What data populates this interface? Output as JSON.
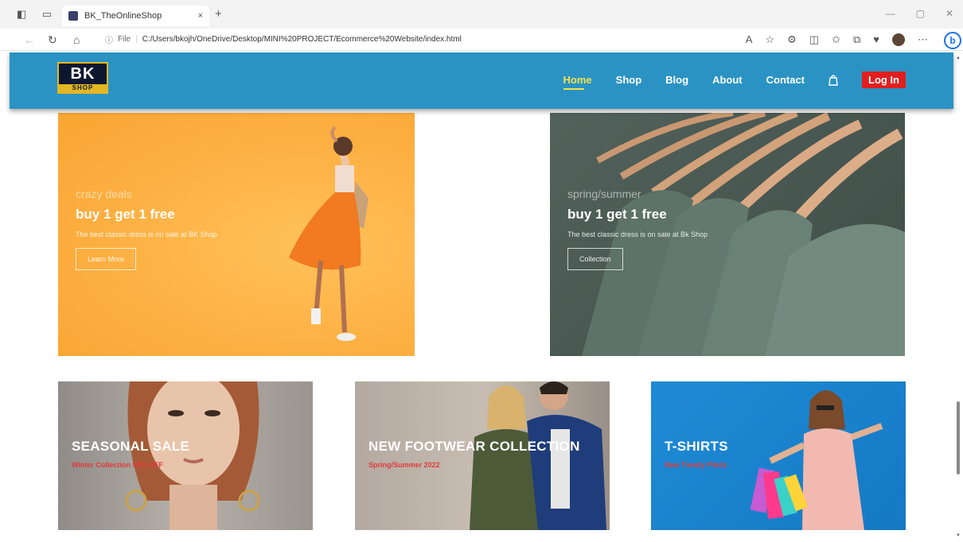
{
  "browser": {
    "tab_title": "BK_TheOnlineShop",
    "tab_close": "×",
    "new_tab": "+",
    "url_info": "ⓘ",
    "url_scheme": "File",
    "url_sep": "|",
    "url": "C:/Users/bkojh/OneDrive/Desktop/MINI%20PROJECT/Ecommerce%20Website/index.html",
    "win_minimize": "—",
    "win_maximize": "▢",
    "win_close": "✕",
    "bing_label": "b"
  },
  "site": {
    "logo_top": "BK",
    "logo_bottom": "SHOP",
    "nav": {
      "home": "Home",
      "shop": "Shop",
      "blog": "Blog",
      "about": "About",
      "contact": "Contact"
    },
    "login": "Log In"
  },
  "banners": {
    "crazy": {
      "kicker": "crazy deals",
      "heading": "buy 1 get 1 free",
      "desc": "The best classic dress is on sale at BK Shop",
      "button": "Learn More"
    },
    "spring": {
      "kicker": "spring/summer",
      "heading": "buy 1 get 1 free",
      "desc": "The best classic dress is on sale at Bk Shop",
      "button": "Collection"
    },
    "seasonal": {
      "heading": "SEASONAL SALE",
      "sub": "Winter Collection 50% OFF"
    },
    "footwear": {
      "heading": "NEW FOOTWEAR COLLECTION",
      "sub": "Spring/Summer 2022"
    },
    "tshirts": {
      "heading": "T-SHIRTS",
      "sub": "New Trendy Prints"
    }
  },
  "colors": {
    "header": "#2b93c3",
    "active_nav": "#f4e04d",
    "login_bg": "#e01f1f",
    "orange_banner": "#fdb042",
    "green_banner": "#4d5c56",
    "tshirt_banner": "#1f8bd6",
    "sub_red": "#e23a3a"
  },
  "icons": [
    "sidebar-icon",
    "tab-actions-icon",
    "back-icon",
    "refresh-icon",
    "home-icon",
    "read-aloud-icon",
    "favorite-icon",
    "extensions-icon",
    "split-screen-icon",
    "favorites-bar-icon",
    "collections-icon",
    "browser-essentials-icon",
    "profile-icon",
    "more-icon",
    "bag-icon"
  ]
}
